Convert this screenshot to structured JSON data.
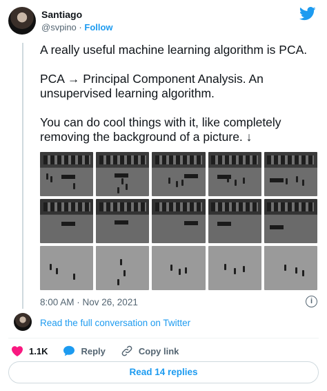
{
  "author": {
    "name": "Santiago",
    "handle": "@svpino",
    "separator": "·",
    "follow_label": "Follow"
  },
  "tweet": {
    "text": "A really useful machine learning algorithm is PCA.\n\nPCA → Principal Component Analysis. An unsupervised learning algorithm.\n\nYou can do cool things with it, like completely removing the background of a picture. ↓",
    "timestamp": "8:00 AM · Nov 26, 2021"
  },
  "thread": {
    "read_full_label": "Read the full conversation on Twitter"
  },
  "actions": {
    "like_count": "1.1K",
    "reply_label": "Reply",
    "copy_link_label": "Copy link"
  },
  "footer": {
    "read_replies_label": "Read 14 replies"
  },
  "colors": {
    "accent": "#1d9bf0",
    "like": "#f91880",
    "muted": "#536471"
  },
  "icons": [
    "twitter-bird-icon",
    "info-icon",
    "heart-icon",
    "reply-bubble-icon",
    "link-icon"
  ]
}
